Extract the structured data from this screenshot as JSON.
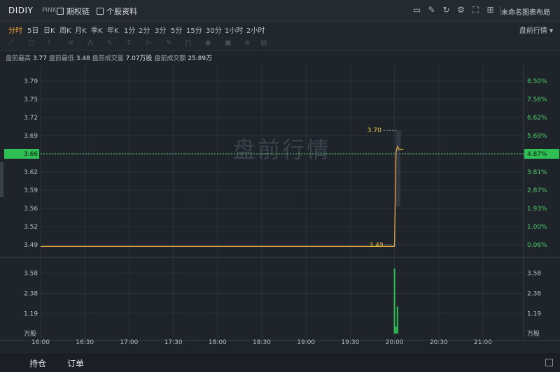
{
  "header": {
    "ticker": "DIDIY",
    "exchange": "PINK",
    "options_chain": "期权链",
    "stock_profile": "个股资料",
    "layout_name": "未命名图表布局"
  },
  "periods": {
    "items": [
      "分时",
      "5日",
      "日K",
      "周K",
      "月K",
      "季K",
      "年K",
      "1分",
      "2分",
      "3分",
      "5分",
      "15分",
      "30分",
      "1小时",
      "2小时"
    ],
    "active": "分时",
    "session": "盘前行情"
  },
  "stats": {
    "high_label": "盘前最高",
    "high": "3.77",
    "low_label": "盘前最低",
    "low": "3.48",
    "vol_label": "盘前成交量",
    "vol": "7.07万股",
    "amt_label": "盘前成交额",
    "amt": "25.89万"
  },
  "chart_data": {
    "type": "line",
    "title": "",
    "watermark": "盘前行情",
    "x_ticks": [
      "16:00",
      "16:30",
      "17:00",
      "17:30",
      "18:00",
      "18:30",
      "19:00",
      "19:30",
      "20:00",
      "20:30",
      "21:00"
    ],
    "price_ticks": [
      "3.79",
      "3.75",
      "3.72",
      "3.69",
      "3.66",
      "3.62",
      "3.59",
      "3.56",
      "3.52",
      "3.49"
    ],
    "pct_ticks": [
      "8.50%",
      "7.56%",
      "6.62%",
      "5.69%",
      "4.87%",
      "3.81%",
      "2.87%",
      "1.93%",
      "1.00%",
      "0.06%"
    ],
    "ylim": [
      3.49,
      3.79
    ],
    "current_price": "3.66",
    "current_pct": "4.87%",
    "price_series": {
      "x": [
        "16:00",
        "20:00",
        "20:01",
        "20:02",
        "20:03",
        "20:04",
        "20:06"
      ],
      "y": [
        3.487,
        3.487,
        3.66,
        3.67,
        3.665,
        3.665,
        3.665
      ]
    },
    "high_marker": {
      "x": "20:02",
      "y": 3.7,
      "label": "3.70"
    },
    "low_marker": {
      "x": "20:00",
      "y": 3.49,
      "label": "3.49"
    },
    "volume": {
      "ticks": [
        "3.58",
        "2.38",
        "1.19"
      ],
      "unit": "万股",
      "ylim": [
        0,
        4.1
      ],
      "bars": [
        {
          "x": "20:00",
          "value": 3.85
        },
        {
          "x": "20:01",
          "value": 0.4
        },
        {
          "x": "20:02",
          "value": 1.6
        }
      ]
    }
  },
  "bottom": {
    "positions": "持仓",
    "orders": "订单"
  }
}
